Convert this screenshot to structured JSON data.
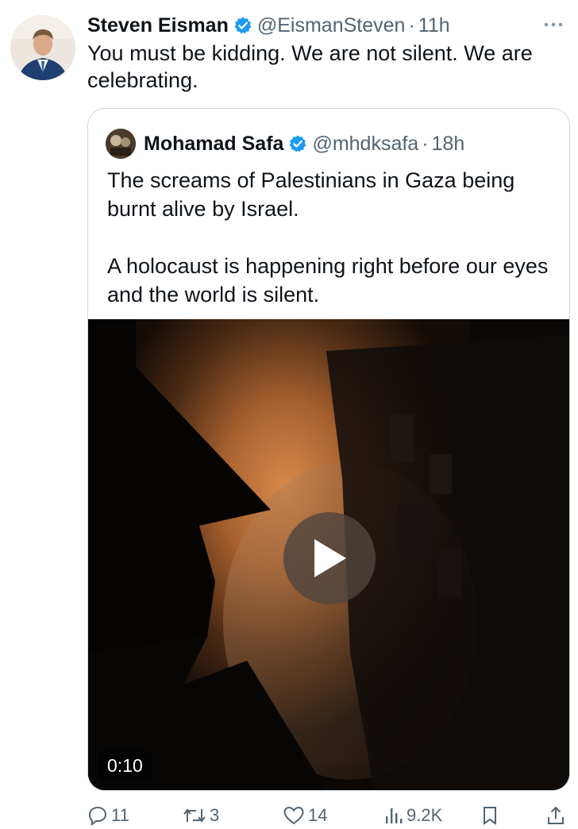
{
  "tweet": {
    "author_name": "Steven Eisman",
    "handle": "@EismanSteven",
    "separator": "·",
    "time": "11h",
    "text": "You must be kidding.  We are not silent. We are celebrating."
  },
  "quoted_tweet": {
    "author_name": "Mohamad Safa",
    "handle": "@mhdksafa",
    "separator": "·",
    "time": "18h",
    "paragraph_1": "The screams of Palestinians in Gaza being burnt alive by Israel.",
    "paragraph_2": "A holocaust is happening right before our eyes and the world is silent.",
    "video": {
      "duration": "0:10"
    }
  },
  "actions": {
    "replies": "11",
    "reposts": "3",
    "likes": "14",
    "views": "9.2K"
  },
  "icons": {
    "verified": "verified-badge-icon",
    "more": "more-options-icon",
    "reply": "reply-icon",
    "repost": "repost-icon",
    "like": "like-icon",
    "views": "views-icon",
    "bookmark": "bookmark-icon",
    "share": "share-icon",
    "play": "play-icon"
  },
  "colors": {
    "verified_blue": "#1d9bf0",
    "text_primary": "#0f1419",
    "text_secondary": "#536471",
    "border": "#cfd9de"
  }
}
